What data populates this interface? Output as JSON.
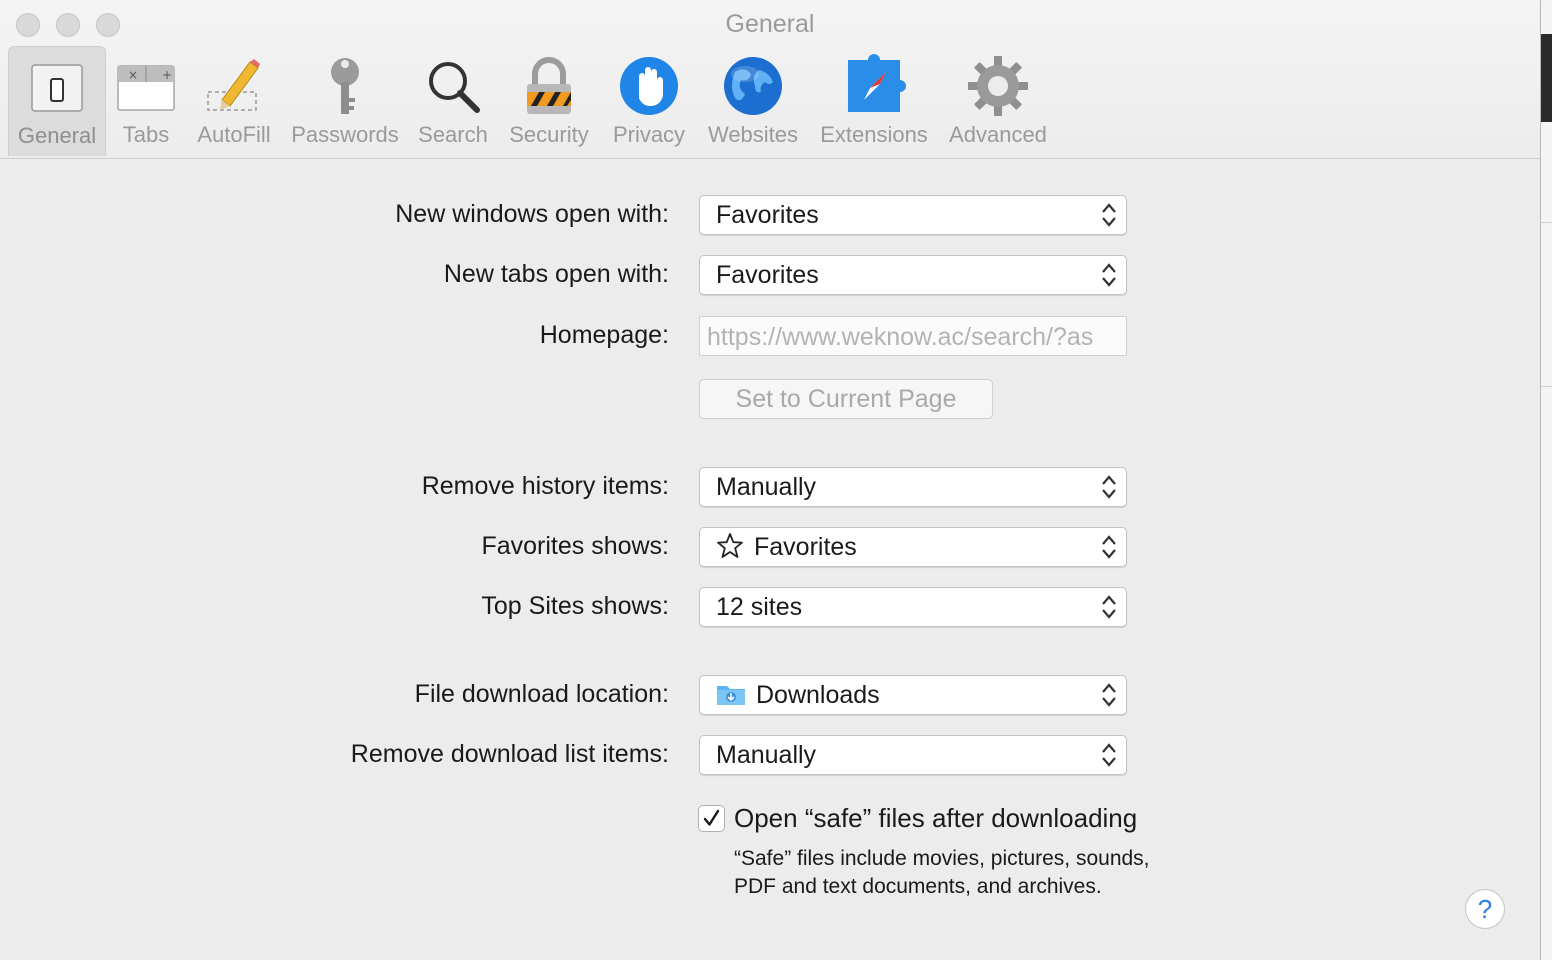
{
  "window": {
    "title": "General"
  },
  "toolbar": {
    "items": [
      {
        "label": "General",
        "icon": "general-switch-icon",
        "selected": true
      },
      {
        "label": "Tabs",
        "icon": "tabs-icon"
      },
      {
        "label": "AutoFill",
        "icon": "pencil-icon"
      },
      {
        "label": "Passwords",
        "icon": "key-icon"
      },
      {
        "label": "Search",
        "icon": "magnifier-icon"
      },
      {
        "label": "Security",
        "icon": "lock-icon"
      },
      {
        "label": "Privacy",
        "icon": "hand-icon"
      },
      {
        "label": "Websites",
        "icon": "globe-icon"
      },
      {
        "label": "Extensions",
        "icon": "puzzle-compass-icon"
      },
      {
        "label": "Advanced",
        "icon": "gear-icon"
      }
    ]
  },
  "settings": {
    "new_windows": {
      "label": "New windows open with:",
      "value": "Favorites"
    },
    "new_tabs": {
      "label": "New tabs open with:",
      "value": "Favorites"
    },
    "homepage": {
      "label": "Homepage:",
      "value": "https://www.weknow.ac/search/?as"
    },
    "set_current_button": "Set to Current Page",
    "remove_history": {
      "label": "Remove history items:",
      "value": "Manually"
    },
    "favorites_shows": {
      "label": "Favorites shows:",
      "value": "Favorites",
      "icon": "star-icon"
    },
    "top_sites_shows": {
      "label": "Top Sites shows:",
      "value": "12 sites"
    },
    "download_location": {
      "label": "File download location:",
      "value": "Downloads",
      "icon": "downloads-folder-icon"
    },
    "remove_download": {
      "label": "Remove download list items:",
      "value": "Manually"
    },
    "open_safe": {
      "label": "Open “safe” files after downloading",
      "checked": true,
      "note": "“Safe” files include movies, pictures, sounds, PDF and text documents, and archives."
    }
  },
  "help_button": "?",
  "colors": {
    "accent": "#2b7cf0",
    "window_bg": "#ececec",
    "label_gray": "#9a9a9a"
  }
}
